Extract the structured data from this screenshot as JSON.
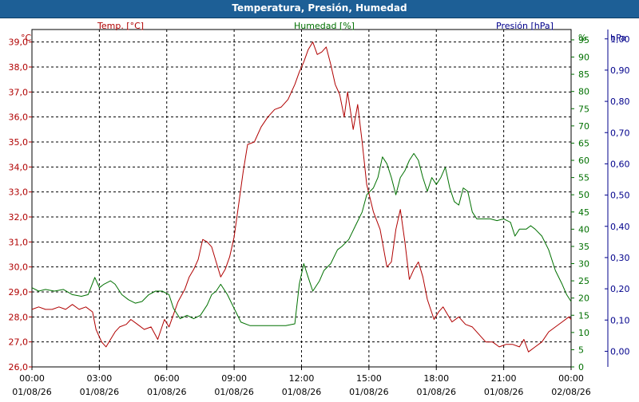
{
  "window": {
    "title": "Temperatura, Presión, Humedad"
  },
  "colors": {
    "titlebar": "#1d5f96",
    "temperature": "#b00000",
    "humidity": "#007000",
    "pressure": "#00008b",
    "grid": "#000000"
  },
  "chart_data": {
    "type": "line",
    "title": "Temperatura, Presión, Humedad",
    "grid": true,
    "grid_style": "dashed",
    "legend": "top",
    "x_ticks": [
      {
        "time": "00:00",
        "date": "01/08/26"
      },
      {
        "time": "03:00",
        "date": "01/08/26"
      },
      {
        "time": "06:00",
        "date": "01/08/26"
      },
      {
        "time": "09:00",
        "date": "01/08/26"
      },
      {
        "time": "12:00",
        "date": "01/08/26"
      },
      {
        "time": "15:00",
        "date": "01/08/26"
      },
      {
        "time": "18:00",
        "date": "01/08/26"
      },
      {
        "time": "21:00",
        "date": "01/08/26"
      },
      {
        "time": "00:00",
        "date": "02/08/26"
      }
    ],
    "xlim_hours": [
      0,
      24
    ],
    "axes": {
      "temperature": {
        "unit": "°C",
        "label": "Temp. [°C]",
        "ylim": [
          26,
          39.5
        ],
        "ticks": [
          "26,0",
          "27,0",
          "28,0",
          "29,0",
          "30,0",
          "31,0",
          "32,0",
          "33,0",
          "34,0",
          "35,0",
          "36,0",
          "37,0",
          "38,0",
          "39,0"
        ]
      },
      "humidity": {
        "unit": "%",
        "label": "Humedad [%]",
        "ylim": [
          0,
          98
        ],
        "ticks": [
          "0",
          "5",
          "10",
          "15",
          "20",
          "25",
          "30",
          "35",
          "40",
          "45",
          "50",
          "55",
          "60",
          "65",
          "70",
          "75",
          "80",
          "85",
          "90",
          "95"
        ]
      },
      "pressure": {
        "unit": "hPa",
        "label": "Presión [hPa]",
        "ylim": [
          -0.05,
          1.03
        ],
        "ticks": [
          "0,00",
          "0,10",
          "0,20",
          "0,30",
          "0,40",
          "0,50",
          "0,60",
          "0,70",
          "0,80",
          "0,90",
          "1,00"
        ]
      }
    },
    "series": [
      {
        "name": "Temp. [°C]",
        "axis": "temperature",
        "points": [
          [
            0,
            28.3
          ],
          [
            0.3,
            28.4
          ],
          [
            0.6,
            28.3
          ],
          [
            0.9,
            28.3
          ],
          [
            1.2,
            28.4
          ],
          [
            1.5,
            28.3
          ],
          [
            1.8,
            28.5
          ],
          [
            2.1,
            28.3
          ],
          [
            2.4,
            28.4
          ],
          [
            2.7,
            28.2
          ],
          [
            2.85,
            27.5
          ],
          [
            3.1,
            27.0
          ],
          [
            3.3,
            26.8
          ],
          [
            3.5,
            27.1
          ],
          [
            3.7,
            27.4
          ],
          [
            3.9,
            27.6
          ],
          [
            4.2,
            27.7
          ],
          [
            4.4,
            27.9
          ],
          [
            4.7,
            27.7
          ],
          [
            5.0,
            27.5
          ],
          [
            5.3,
            27.6
          ],
          [
            5.6,
            27.1
          ],
          [
            5.9,
            27.9
          ],
          [
            6.1,
            27.6
          ],
          [
            6.3,
            28.1
          ],
          [
            6.5,
            28.6
          ],
          [
            6.8,
            29.1
          ],
          [
            7.0,
            29.6
          ],
          [
            7.2,
            29.9
          ],
          [
            7.4,
            30.3
          ],
          [
            7.6,
            31.1
          ],
          [
            7.8,
            31.0
          ],
          [
            8.0,
            30.8
          ],
          [
            8.2,
            30.2
          ],
          [
            8.4,
            29.6
          ],
          [
            8.6,
            29.9
          ],
          [
            8.8,
            30.4
          ],
          [
            9.0,
            31.2
          ],
          [
            9.2,
            32.5
          ],
          [
            9.4,
            33.8
          ],
          [
            9.6,
            34.9
          ],
          [
            9.9,
            35.0
          ],
          [
            10.2,
            35.6
          ],
          [
            10.5,
            36.0
          ],
          [
            10.8,
            36.3
          ],
          [
            11.1,
            36.4
          ],
          [
            11.4,
            36.7
          ],
          [
            11.7,
            37.3
          ],
          [
            11.9,
            37.8
          ],
          [
            12.1,
            38.2
          ],
          [
            12.3,
            38.7
          ],
          [
            12.5,
            39.0
          ],
          [
            12.7,
            38.5
          ],
          [
            12.9,
            38.6
          ],
          [
            13.1,
            38.8
          ],
          [
            13.3,
            38.1
          ],
          [
            13.5,
            37.3
          ],
          [
            13.7,
            36.9
          ],
          [
            13.9,
            36.0
          ],
          [
            14.05,
            37.0
          ],
          [
            14.3,
            35.5
          ],
          [
            14.5,
            36.5
          ],
          [
            14.7,
            35.0
          ],
          [
            14.9,
            33.3
          ],
          [
            15.2,
            32.2
          ],
          [
            15.5,
            31.5
          ],
          [
            15.8,
            30.0
          ],
          [
            16.0,
            30.2
          ],
          [
            16.2,
            31.5
          ],
          [
            16.4,
            32.3
          ],
          [
            16.6,
            31.0
          ],
          [
            16.8,
            29.5
          ],
          [
            17.0,
            29.9
          ],
          [
            17.2,
            30.2
          ],
          [
            17.4,
            29.6
          ],
          [
            17.6,
            28.7
          ],
          [
            17.9,
            27.9
          ],
          [
            18.1,
            28.2
          ],
          [
            18.3,
            28.4
          ],
          [
            18.5,
            28.1
          ],
          [
            18.7,
            27.8
          ],
          [
            19.0,
            28.0
          ],
          [
            19.3,
            27.7
          ],
          [
            19.6,
            27.6
          ],
          [
            19.9,
            27.3
          ],
          [
            20.2,
            27.0
          ],
          [
            20.5,
            27.0
          ],
          [
            20.8,
            26.8
          ],
          [
            21.1,
            26.9
          ],
          [
            21.4,
            26.9
          ],
          [
            21.7,
            26.8
          ],
          [
            21.9,
            27.1
          ],
          [
            22.1,
            26.6
          ],
          [
            22.4,
            26.8
          ],
          [
            22.7,
            27.0
          ],
          [
            23.0,
            27.4
          ],
          [
            23.3,
            27.6
          ],
          [
            23.6,
            27.8
          ],
          [
            23.9,
            28.0
          ],
          [
            24.0,
            27.9
          ]
        ]
      },
      {
        "name": "Humedad [%]",
        "axis": "humidity",
        "points": [
          [
            0,
            23
          ],
          [
            0.3,
            22
          ],
          [
            0.6,
            22.5
          ],
          [
            1.0,
            22
          ],
          [
            1.4,
            22.5
          ],
          [
            1.8,
            21
          ],
          [
            2.2,
            20.5
          ],
          [
            2.5,
            21
          ],
          [
            2.8,
            26
          ],
          [
            3.0,
            23
          ],
          [
            3.2,
            24
          ],
          [
            3.5,
            25
          ],
          [
            3.7,
            24
          ],
          [
            4.0,
            21
          ],
          [
            4.3,
            19.5
          ],
          [
            4.6,
            18.5
          ],
          [
            4.9,
            19
          ],
          [
            5.2,
            21
          ],
          [
            5.5,
            22
          ],
          [
            5.8,
            22
          ],
          [
            6.1,
            21
          ],
          [
            6.3,
            17
          ],
          [
            6.6,
            14
          ],
          [
            6.9,
            15
          ],
          [
            7.2,
            14
          ],
          [
            7.5,
            15
          ],
          [
            7.8,
            18
          ],
          [
            8.0,
            21
          ],
          [
            8.2,
            22
          ],
          [
            8.4,
            24
          ],
          [
            8.7,
            21
          ],
          [
            9.0,
            17
          ],
          [
            9.3,
            13
          ],
          [
            9.7,
            12
          ],
          [
            10.1,
            12
          ],
          [
            10.5,
            12
          ],
          [
            10.9,
            12
          ],
          [
            11.3,
            12
          ],
          [
            11.7,
            12.5
          ],
          [
            11.9,
            24
          ],
          [
            12.1,
            30
          ],
          [
            12.3,
            26
          ],
          [
            12.5,
            22
          ],
          [
            12.8,
            25
          ],
          [
            13.0,
            28
          ],
          [
            13.3,
            30
          ],
          [
            13.6,
            34
          ],
          [
            13.8,
            35
          ],
          [
            14.1,
            37
          ],
          [
            14.4,
            41
          ],
          [
            14.7,
            45
          ],
          [
            14.9,
            50
          ],
          [
            15.2,
            52
          ],
          [
            15.4,
            55
          ],
          [
            15.6,
            61
          ],
          [
            15.8,
            59
          ],
          [
            16.0,
            55
          ],
          [
            16.2,
            50
          ],
          [
            16.4,
            55
          ],
          [
            16.6,
            57
          ],
          [
            16.8,
            60
          ],
          [
            17.0,
            62
          ],
          [
            17.2,
            60
          ],
          [
            17.4,
            55
          ],
          [
            17.6,
            51
          ],
          [
            17.8,
            55
          ],
          [
            18.0,
            53
          ],
          [
            18.2,
            55
          ],
          [
            18.4,
            58
          ],
          [
            18.6,
            52
          ],
          [
            18.8,
            48
          ],
          [
            19.0,
            47
          ],
          [
            19.2,
            52
          ],
          [
            19.4,
            51
          ],
          [
            19.6,
            45
          ],
          [
            19.8,
            43
          ],
          [
            20.1,
            43
          ],
          [
            20.4,
            43
          ],
          [
            20.7,
            42.5
          ],
          [
            21.0,
            43
          ],
          [
            21.3,
            42
          ],
          [
            21.5,
            38
          ],
          [
            21.7,
            40
          ],
          [
            22.0,
            40
          ],
          [
            22.2,
            41
          ],
          [
            22.4,
            40
          ],
          [
            22.7,
            38
          ],
          [
            23.0,
            34
          ],
          [
            23.3,
            28
          ],
          [
            23.6,
            24
          ],
          [
            23.8,
            21
          ],
          [
            24.0,
            19
          ]
        ]
      },
      {
        "name": "Presión [hPa]",
        "axis": "pressure",
        "points": []
      }
    ]
  }
}
